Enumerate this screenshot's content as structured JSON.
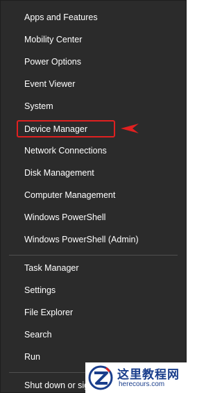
{
  "menu": {
    "items": [
      {
        "label": "Apps and Features"
      },
      {
        "label": "Mobility Center"
      },
      {
        "label": "Power Options"
      },
      {
        "label": "Event Viewer"
      },
      {
        "label": "System"
      },
      {
        "label": "Device Manager"
      },
      {
        "label": "Network Connections"
      },
      {
        "label": "Disk Management"
      },
      {
        "label": "Computer Management"
      },
      {
        "label": "Windows PowerShell"
      },
      {
        "label": "Windows PowerShell (Admin)"
      },
      {
        "label": "Task Manager"
      },
      {
        "label": "Settings"
      },
      {
        "label": "File Explorer"
      },
      {
        "label": "Search"
      },
      {
        "label": "Run"
      },
      {
        "label": "Shut down or sign out"
      }
    ]
  },
  "annotation": {
    "highlight_color": "#e02020"
  },
  "watermark": {
    "title": "这里教程网",
    "url": "herecours.com",
    "color": "#1a3e8c"
  }
}
